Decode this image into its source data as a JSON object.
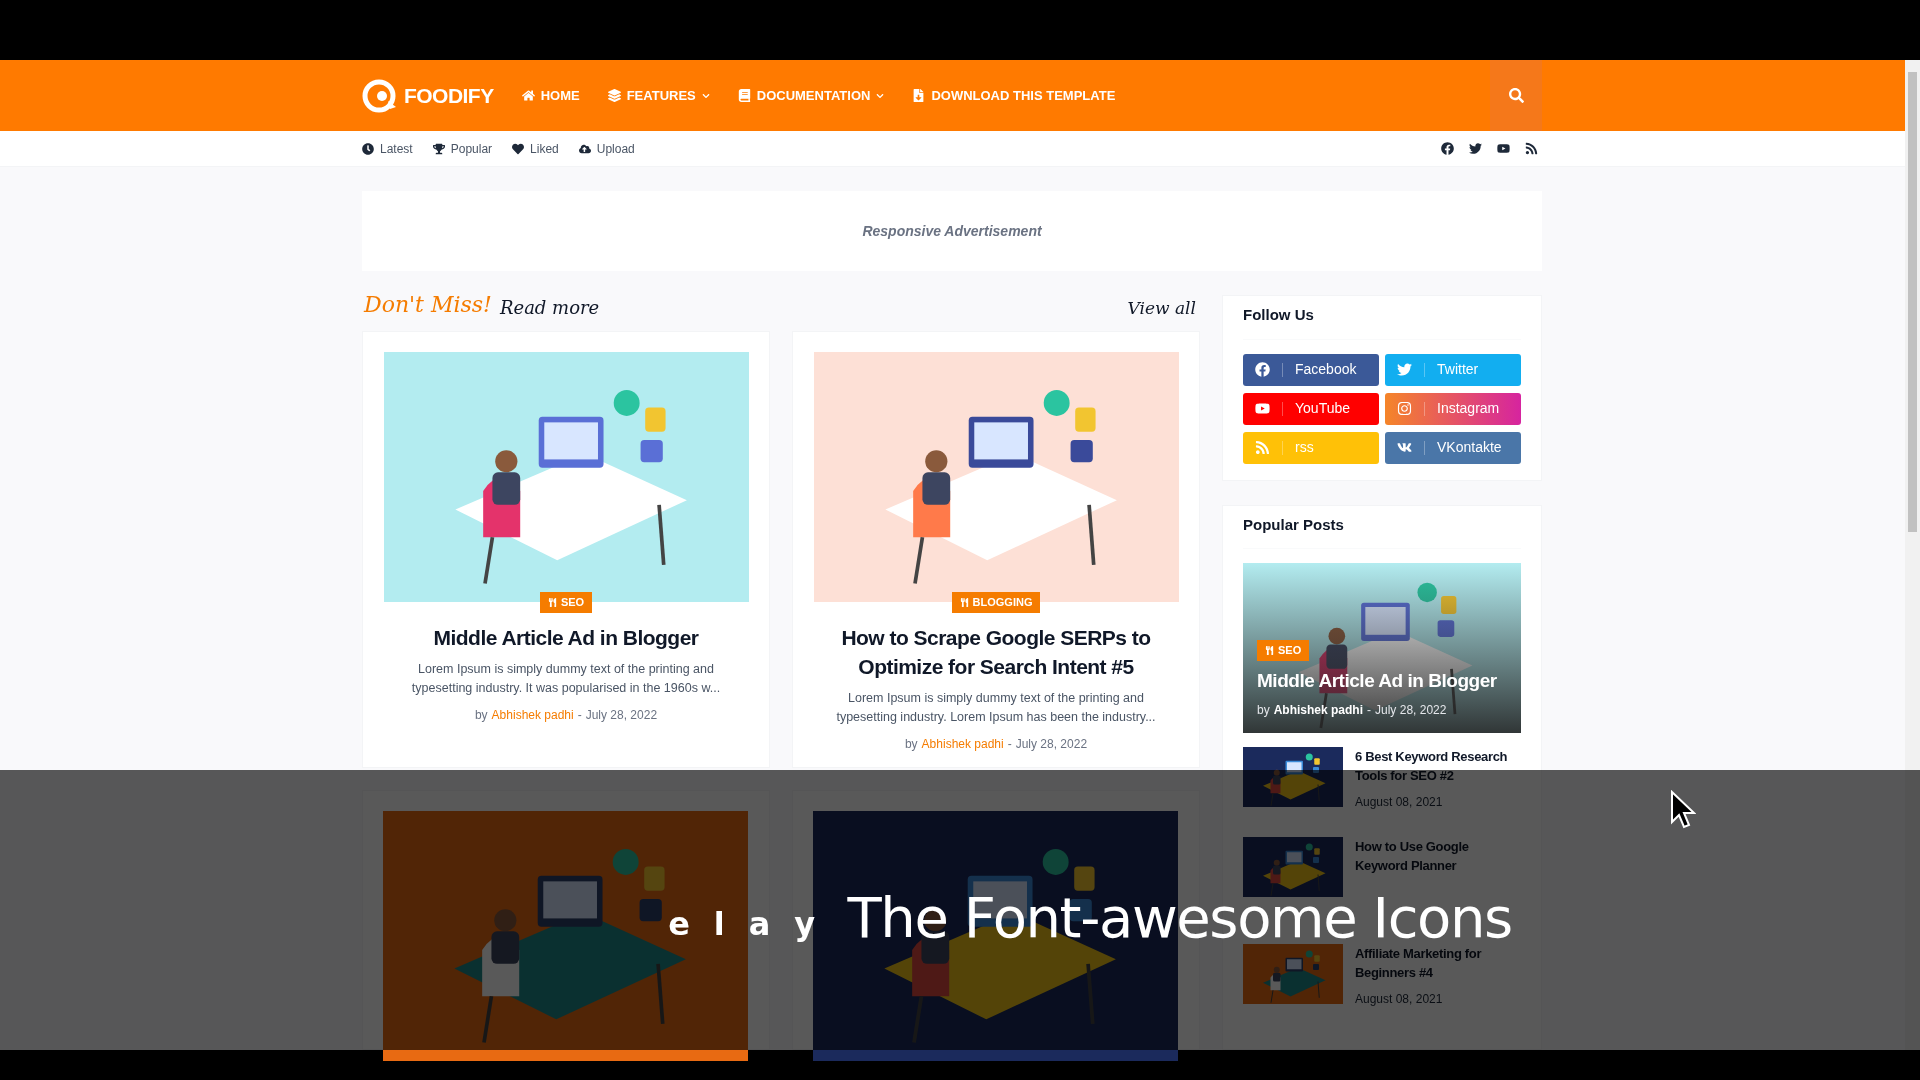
{
  "nav": {
    "logo": "FOODIFY",
    "items": [
      {
        "label": "HOME",
        "dropdown": false
      },
      {
        "label": "FEATURES",
        "dropdown": true
      },
      {
        "label": "DOCUMENTATION",
        "dropdown": true
      },
      {
        "label": "DOWNLOAD THIS TEMPLATE",
        "dropdown": false
      }
    ]
  },
  "subnav": {
    "links": [
      {
        "label": "Latest"
      },
      {
        "label": "Popular"
      },
      {
        "label": "Liked"
      },
      {
        "label": "Upload"
      }
    ],
    "social": [
      {
        "kind": "facebook"
      },
      {
        "kind": "twitter"
      },
      {
        "kind": "youtube"
      },
      {
        "kind": "rss"
      }
    ]
  },
  "ad": {
    "text": "Responsive Advertisement"
  },
  "section": {
    "title_accent": "Don't Miss!",
    "title": "Read more",
    "view_all": "View all"
  },
  "cards": [
    {
      "category": "SEO",
      "title": "Middle Article Ad in Blogger",
      "excerpt": "Lorem Ipsum is simply dummy text of the printing and typesetting industry. It was popularised in the 1960s w...",
      "by": "by",
      "author": "Abhishek padhi",
      "sep": "-",
      "date": "July 28, 2022"
    },
    {
      "category": "BLOGGING",
      "title": "How to Scrape Google SERPs to Optimize for Search Intent #5",
      "excerpt": "Lorem Ipsum is simply dummy text of the printing and typesetting industry. Lorem Ipsum has been the industry...",
      "by": "by",
      "author": "Abhishek padhi",
      "sep": "-",
      "date": "July 28, 2022"
    }
  ],
  "follow": {
    "title": "Follow Us",
    "buttons": [
      {
        "label": "Facebook",
        "kind": "facebook",
        "color": "#3b5998"
      },
      {
        "label": "Twitter",
        "kind": "twitter",
        "color": "#12aef0"
      },
      {
        "label": "YouTube",
        "kind": "youtube",
        "color": "#ff0000"
      },
      {
        "label": "Instagram",
        "kind": "instagram",
        "color": "#d6249f"
      },
      {
        "label": "rss",
        "kind": "rss",
        "color": "#ffc107"
      },
      {
        "label": "VKontakte",
        "kind": "vk",
        "color": "#4a76a8"
      }
    ]
  },
  "popular": {
    "title": "Popular Posts",
    "featured": {
      "category": "SEO",
      "title": "Middle Article Ad in Blogger",
      "by": "by",
      "author": "Abhishek padhi",
      "sep": "-",
      "date": "July 28, 2022"
    },
    "items": [
      {
        "title": "6 Best Keyword Research Tools for SEO #2",
        "date": "August 08, 2021"
      },
      {
        "title": "How to Use Google Keyword Planner"
      },
      {
        "title": "Affiliate Marketing for Beginners #4",
        "date": "August 08, 2021"
      }
    ]
  },
  "caption": {
    "lead": "e l a y",
    "text": "The Font-awesome Icons"
  }
}
